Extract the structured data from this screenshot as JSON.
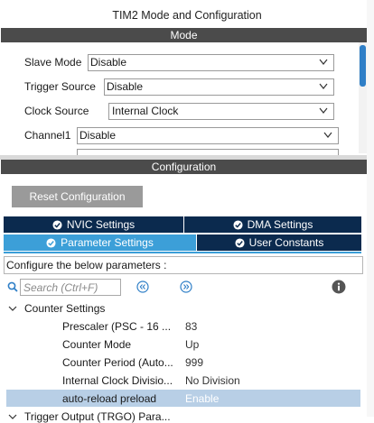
{
  "window": {
    "title": "TIM2 Mode and Configuration"
  },
  "mode_section": {
    "header": "Mode",
    "fields": [
      {
        "label": "Slave Mode",
        "value": "Disable"
      },
      {
        "label": "Trigger Source",
        "value": "Disable"
      },
      {
        "label": "Clock Source",
        "value": "Internal Clock"
      },
      {
        "label": "Channel1",
        "value": "Disable"
      }
    ]
  },
  "config_section": {
    "header": "Configuration",
    "reset_label": "Reset Configuration",
    "tabs": [
      {
        "label": "NVIC Settings",
        "active": false
      },
      {
        "label": "DMA Settings",
        "active": false
      },
      {
        "label": "Parameter Settings",
        "active": true
      },
      {
        "label": "User Constants",
        "active": false
      }
    ],
    "hint": "Configure the below parameters :",
    "search": {
      "placeholder": "Search (Ctrl+F)"
    },
    "groups": [
      {
        "name": "Counter Settings",
        "params": [
          {
            "name": "Prescaler (PSC - 16 ...",
            "value": "83"
          },
          {
            "name": "Counter Mode",
            "value": "Up"
          },
          {
            "name": "Counter Period (Auto...",
            "value": "999"
          },
          {
            "name": "Internal Clock Divisio...",
            "value": "No Division"
          },
          {
            "name": "auto-reload preload",
            "value": "Enable"
          }
        ]
      },
      {
        "name": "Trigger Output (TRGO) Para..."
      }
    ]
  },
  "colors": {
    "section_bar": "#4b4b4b",
    "tab_dark": "#0b2a4e",
    "tab_active": "#3c9fd8",
    "selected_row": "#b8cfe6",
    "check_icon": "#2e9e44"
  }
}
